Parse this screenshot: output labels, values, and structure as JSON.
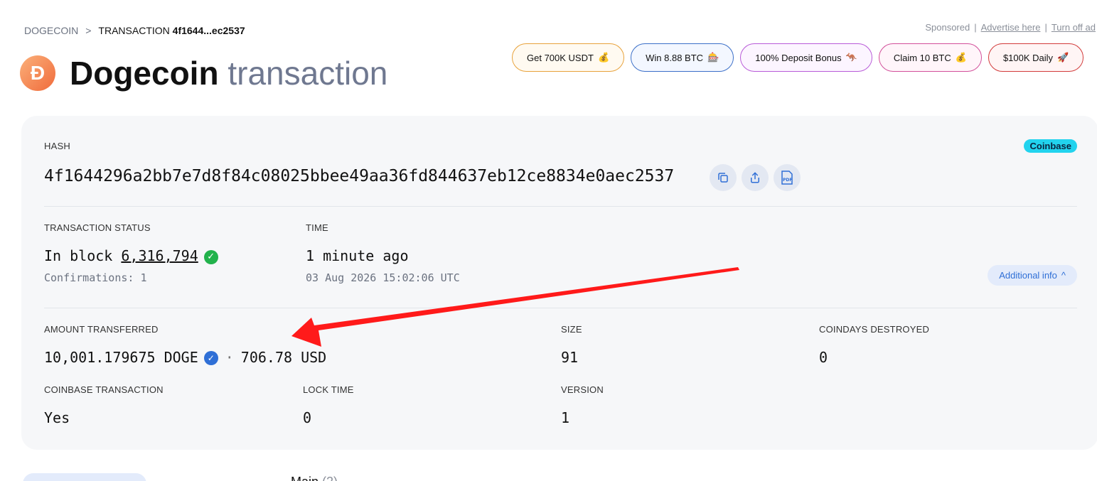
{
  "breadcrumb": {
    "root": "DOGECOIN",
    "separator": ">",
    "current_prefix": "TRANSACTION",
    "current_hash": "4f1644...ec2537"
  },
  "page": {
    "logo_letter": "Ð",
    "title_main": "Dogecoin",
    "title_sub": "transaction"
  },
  "sponsor": {
    "label": "Sponsored",
    "sep1": "|",
    "advertise": "Advertise here",
    "sep2": "|",
    "turn_off": "Turn off ad"
  },
  "ads": [
    {
      "label": "Get 700K USDT",
      "emoji": "💰"
    },
    {
      "label": "Win 8.88 BTC",
      "emoji": "🎰"
    },
    {
      "label": "100% Deposit Bonus",
      "emoji": "🦘"
    },
    {
      "label": "Claim 10 BTC",
      "emoji": "💰"
    },
    {
      "label": "$100K Daily",
      "emoji": "🚀"
    }
  ],
  "transaction": {
    "hash_label": "HASH",
    "badge": "Coinbase",
    "hash": "4f1644296a2bb7e7d8f84c08025bbee49aa36fd844637eb12ce8834e0aec2537",
    "status_label": "TRANSACTION STATUS",
    "status_prefix": "In block",
    "block": "6,316,794",
    "confirmations": "Confirmations: 1",
    "time_label": "TIME",
    "time_relative": "1 minute ago",
    "time_absolute": "03 Aug 2026 15:02:06 UTC",
    "additional_info": "Additional info",
    "amount_label": "AMOUNT TRANSFERRED",
    "amount_doge": "10,001.179675 DOGE",
    "amount_sep": "·",
    "amount_usd": "706.78 USD",
    "size_label": "SIZE",
    "size": "91",
    "coindays_label": "COINDAYS DESTROYED",
    "coindays": "0",
    "coinbase_label": "COINBASE TRANSACTION",
    "coinbase": "Yes",
    "locktime_label": "LOCK TIME",
    "locktime": "0",
    "version_label": "VERSION",
    "version": "1"
  },
  "bottom": {
    "main_tab": "Main",
    "main_count": "(2)"
  },
  "colors": {
    "accent": "#2f6fd6",
    "success": "#22b24c",
    "badge": "#22d3ee",
    "arrow": "#ff1a1a"
  }
}
